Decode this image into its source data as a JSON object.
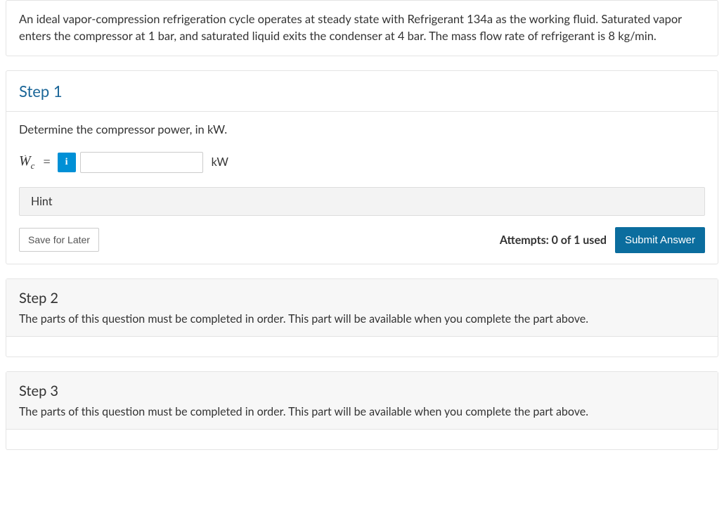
{
  "problem": {
    "statement": "An ideal vapor-compression refrigeration cycle operates at steady state with Refrigerant 134a as the working fluid. Saturated vapor enters the compressor at 1 bar, and saturated liquid exits the condenser at 4 bar. The mass flow rate of refrigerant is 8 kg/min."
  },
  "step1": {
    "title": "Step 1",
    "question": "Determine the compressor power, in kW.",
    "variable_main": "W",
    "variable_sub": "c",
    "equals": "=",
    "info_icon": "i",
    "input_value": "",
    "unit": "kW",
    "hint_label": "Hint",
    "save_label": "Save for Later",
    "attempts_label": "Attempts: 0 of 1 used",
    "submit_label": "Submit Answer"
  },
  "step2": {
    "title": "Step 2",
    "locked_message": "The parts of this question must be completed in order. This part will be available when you complete the part above."
  },
  "step3": {
    "title": "Step 3",
    "locked_message": "The parts of this question must be completed in order. This part will be available when you complete the part above."
  }
}
